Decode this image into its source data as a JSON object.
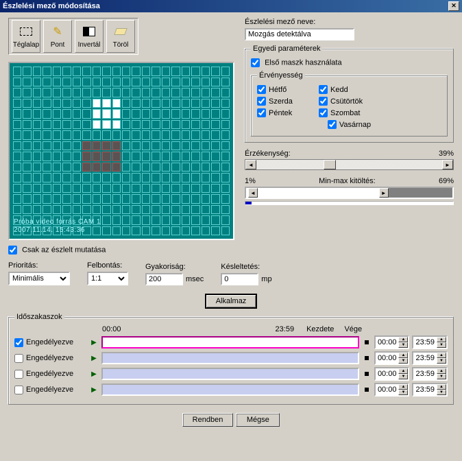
{
  "window": {
    "title": "Észlelési mező módosítása"
  },
  "tools": [
    {
      "label": "Téglalap",
      "icon": "rect"
    },
    {
      "label": "Pont",
      "icon": "pencil"
    },
    {
      "label": "Invertál",
      "icon": "invert"
    },
    {
      "label": "Töröl",
      "icon": "eraser"
    }
  ],
  "preview_overlay": {
    "line1": "Próba video forrás CAM 1",
    "line2": "2007.11.14.  15:43:36"
  },
  "field_name": {
    "label": "Észlelési mező neve:",
    "value": "Mozgás detektálva"
  },
  "params_group": "Egyedi paraméterek",
  "use_first_mask": {
    "label": "Első maszk használata",
    "checked": true
  },
  "validity": {
    "legend": "Érvényesség",
    "days": [
      {
        "label": "Hétfő",
        "checked": true
      },
      {
        "label": "Kedd",
        "checked": true
      },
      {
        "label": "Szerda",
        "checked": true
      },
      {
        "label": "Csütörtök",
        "checked": true
      },
      {
        "label": "Péntek",
        "checked": true
      },
      {
        "label": "Szombat",
        "checked": true
      },
      {
        "label": "Vasárnap",
        "checked": true
      }
    ]
  },
  "sensitivity": {
    "label": "Érzékenység:",
    "value_pct": "39%",
    "thumb_left_pct": 36
  },
  "minmax": {
    "left": "1%",
    "label": "Min-max kitöltés:",
    "right": "69%",
    "low_pct": 1,
    "high_pct": 69,
    "progress_pct": 3
  },
  "only_detected": {
    "label": "Csak az észlelt mutatása",
    "checked": true
  },
  "priority": {
    "label": "Prioritás:",
    "value": "Minimális"
  },
  "resolution": {
    "label": "Felbontás:",
    "value": "1:1"
  },
  "frequency": {
    "label": "Gyakoriság:",
    "value": "200",
    "unit": "msec"
  },
  "delay": {
    "label": "Késleltetés:",
    "value": "0",
    "unit": "mp"
  },
  "apply": "Alkalmaz",
  "timeslots": {
    "legend": "Időszakaszok",
    "header_start": "00:00",
    "header_end": "23:59",
    "col_start": "Kezdete",
    "col_end": "Vége",
    "rows": [
      {
        "enabled": true,
        "label": "Engedélyezve",
        "start": "00:00",
        "end": "23:59"
      },
      {
        "enabled": false,
        "label": "Engedélyezve",
        "start": "00:00",
        "end": "23:59"
      },
      {
        "enabled": false,
        "label": "Engedélyezve",
        "start": "00:00",
        "end": "23:59"
      },
      {
        "enabled": false,
        "label": "Engedélyezve",
        "start": "00:00",
        "end": "23:59"
      }
    ]
  },
  "buttons": {
    "ok": "Rendben",
    "cancel": "Mégse"
  }
}
